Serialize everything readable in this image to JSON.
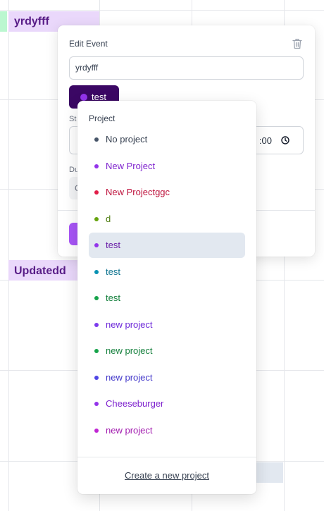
{
  "calendar": {
    "events": [
      {
        "title": "yrdyfff"
      },
      {
        "title": "Updatedd"
      }
    ]
  },
  "edit_event": {
    "header": "Edit Event",
    "title_value": "yrdyfff",
    "project_button": {
      "label": "test",
      "color": "#9333ea"
    },
    "start_label": "St",
    "start_time_tail": ":00",
    "duration_label": "Du",
    "duration_value": "C"
  },
  "project_menu": {
    "header": "Project",
    "items": [
      {
        "label": "No project",
        "color": "#475569",
        "text_color": "#374151"
      },
      {
        "label": "New Project",
        "color": "#9333ea",
        "text_color": "#7e22ce"
      },
      {
        "label": "New Projectggc",
        "color": "#e11d48",
        "text_color": "#be123c"
      },
      {
        "label": "d",
        "color": "#65a30d",
        "text_color": "#4d7c0f"
      },
      {
        "label": "test",
        "color": "#9333ea",
        "text_color": "#6b21a8",
        "selected": true
      },
      {
        "label": "test",
        "color": "#0891b2",
        "text_color": "#0e7490"
      },
      {
        "label": "test",
        "color": "#16a34a",
        "text_color": "#15803d"
      },
      {
        "label": "new project",
        "color": "#7c3aed",
        "text_color": "#6d28d9"
      },
      {
        "label": "new project",
        "color": "#16a34a",
        "text_color": "#15803d"
      },
      {
        "label": "new project",
        "color": "#4f46e5",
        "text_color": "#4338ca"
      },
      {
        "label": "Cheeseburger",
        "color": "#9333ea",
        "text_color": "#7e22ce"
      },
      {
        "label": "new project",
        "color": "#c026d3",
        "text_color": "#a21caf"
      }
    ],
    "create_label": "Create a new project"
  }
}
